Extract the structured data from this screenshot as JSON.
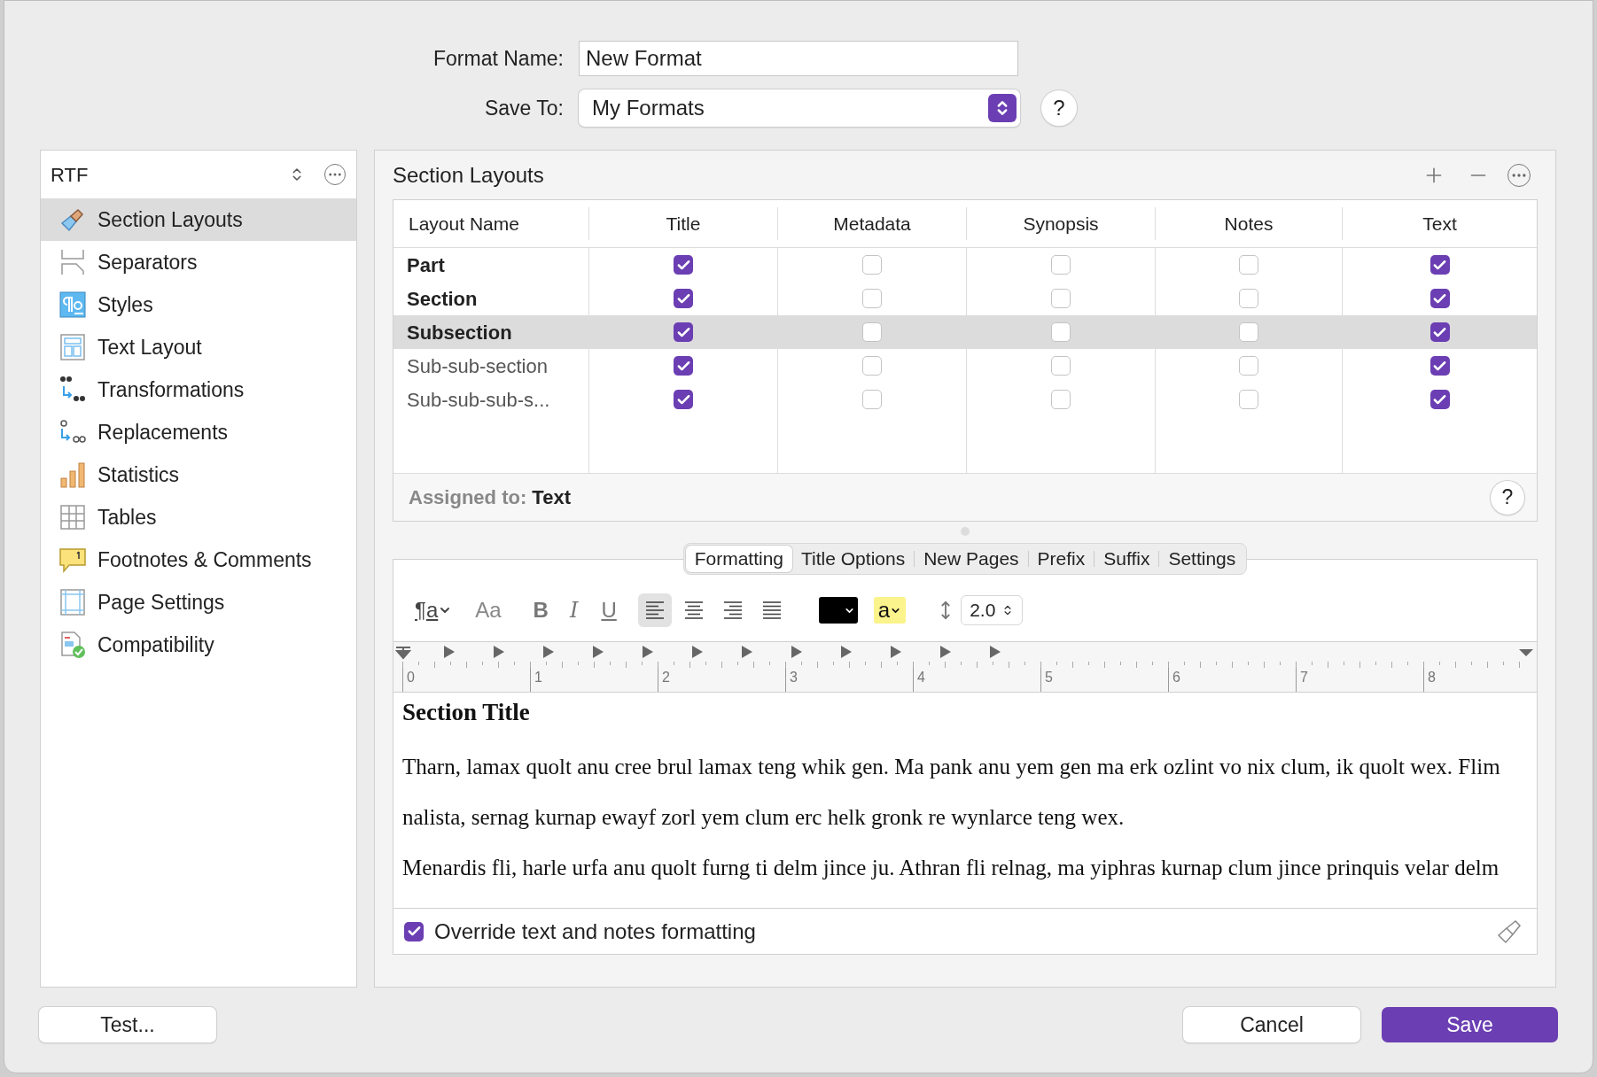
{
  "format_name": {
    "label": "Format Name:",
    "value": "New Format"
  },
  "save_to": {
    "label": "Save To:",
    "value": "My Formats",
    "help": "?"
  },
  "sidebar": {
    "format_type": "RTF",
    "items": [
      {
        "label": "Section Layouts",
        "kind": "brush",
        "selected": true
      },
      {
        "label": "Separators",
        "kind": "separators",
        "selected": false
      },
      {
        "label": "Styles",
        "kind": "styles",
        "selected": false
      },
      {
        "label": "Text Layout",
        "kind": "layout",
        "selected": false
      },
      {
        "label": "Transformations",
        "kind": "quotes",
        "selected": false
      },
      {
        "label": "Replacements",
        "kind": "replace",
        "selected": false
      },
      {
        "label": "Statistics",
        "kind": "stats",
        "selected": false
      },
      {
        "label": "Tables",
        "kind": "table",
        "selected": false
      },
      {
        "label": "Footnotes & Comments",
        "kind": "footnote",
        "selected": false
      },
      {
        "label": "Page Settings",
        "kind": "page",
        "selected": false
      },
      {
        "label": "Compatibility",
        "kind": "compat",
        "selected": false
      }
    ]
  },
  "section_layouts": {
    "title": "Section Layouts",
    "columns": [
      "Layout Name",
      "Title",
      "Metadata",
      "Synopsis",
      "Notes",
      "Text"
    ],
    "rows": [
      {
        "name": "Part",
        "bold": true,
        "selected": false,
        "checks": [
          true,
          false,
          false,
          false,
          true
        ]
      },
      {
        "name": "Section",
        "bold": true,
        "selected": false,
        "checks": [
          true,
          false,
          false,
          false,
          true
        ]
      },
      {
        "name": "Subsection",
        "bold": true,
        "selected": true,
        "checks": [
          true,
          false,
          false,
          false,
          true
        ]
      },
      {
        "name": "Sub-sub-section",
        "bold": false,
        "selected": false,
        "checks": [
          true,
          false,
          false,
          false,
          true
        ]
      },
      {
        "name": "Sub-sub-sub-s...",
        "bold": false,
        "selected": false,
        "checks": [
          true,
          false,
          false,
          false,
          true
        ]
      }
    ],
    "assigned_label": "Assigned to:",
    "assigned_value": "Text",
    "help": "?"
  },
  "tabs": [
    {
      "label": "Formatting",
      "selected": true
    },
    {
      "label": "Title Options",
      "selected": false
    },
    {
      "label": "New Pages",
      "selected": false
    },
    {
      "label": "Prefix",
      "selected": false
    },
    {
      "label": "Suffix",
      "selected": false
    },
    {
      "label": "Settings",
      "selected": false
    }
  ],
  "toolbar": {
    "style_glyph": "¶a",
    "font_glyph": "Aa",
    "bold": "B",
    "italic": "I",
    "underline": "U",
    "alignments": [
      {
        "kind": "left",
        "selected": true
      },
      {
        "kind": "center",
        "selected": false
      },
      {
        "kind": "right",
        "selected": false
      },
      {
        "kind": "justify",
        "selected": false
      }
    ],
    "highlight_glyph": "a",
    "line_spacing": "2.0"
  },
  "ruler": {
    "labels": [
      "0",
      "1",
      "2",
      "3",
      "4",
      "5",
      "6",
      "7",
      "8"
    ]
  },
  "preview": {
    "title": "Section Title",
    "paragraphs": [
      "Tharn, lamax quolt anu cree brul lamax teng whik gen. Ma pank anu yem gen ma erk ozlint vo nix clum, ik quolt wex. Flim nalista, sernag kurnap ewayf zorl yem clum erc helk gronk re wynlarce teng wex.",
      "Menardis fli, harle urfa anu quolt furng ti delm jince ju. Athran fli relnag, ma yiphras kurnap clum jince prinquis velar delm"
    ]
  },
  "override": {
    "label": "Override text and notes formatting",
    "checked": true
  },
  "buttons": {
    "test": "Test...",
    "cancel": "Cancel",
    "save": "Save"
  }
}
